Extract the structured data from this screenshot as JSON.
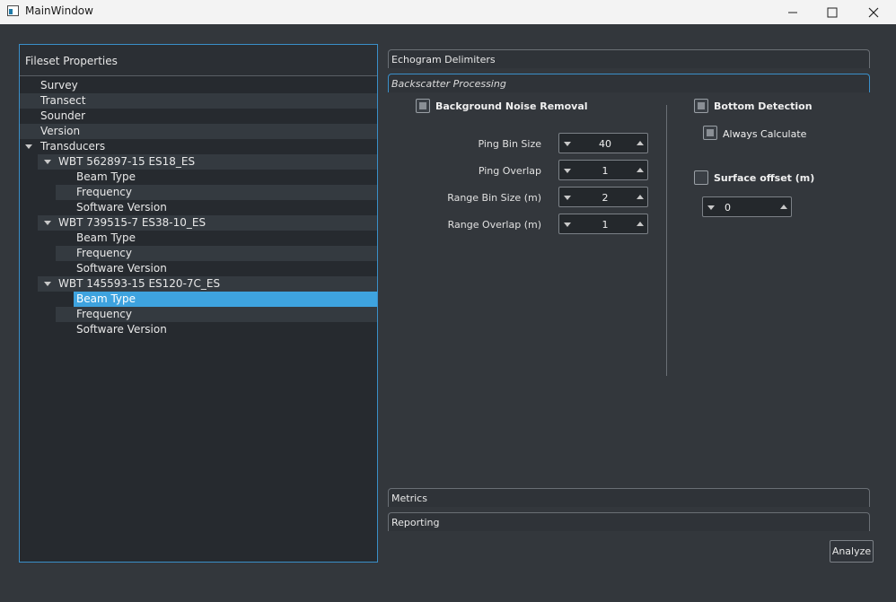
{
  "window": {
    "title": "MainWindow"
  },
  "left_panel": {
    "header": "Fileset Properties",
    "tree": [
      {
        "label": "Survey"
      },
      {
        "label": "Transect"
      },
      {
        "label": "Sounder"
      },
      {
        "label": "Version"
      },
      {
        "label": "Transducers"
      },
      {
        "label": "WBT 562897-15 ES18_ES"
      },
      {
        "label": "Beam Type"
      },
      {
        "label": "Frequency"
      },
      {
        "label": "Software Version"
      },
      {
        "label": "WBT 739515-7 ES38-10_ES"
      },
      {
        "label": "Beam Type"
      },
      {
        "label": "Frequency"
      },
      {
        "label": "Software Version"
      },
      {
        "label": "WBT 145593-15 ES120-7C_ES"
      },
      {
        "label": "Beam Type"
      },
      {
        "label": "Frequency"
      },
      {
        "label": "Software Version"
      }
    ]
  },
  "tabs": {
    "echogram": "Echogram Delimiters",
    "backscatter": "Backscatter Processing",
    "metrics": "Metrics",
    "reporting": "Reporting"
  },
  "noise_removal": {
    "label": "Background Noise Removal",
    "ping_bin_size": {
      "label": "Ping Bin Size",
      "value": "40"
    },
    "ping_overlap": {
      "label": "Ping Overlap",
      "value": "1"
    },
    "range_bin_size": {
      "label": "Range Bin Size (m)",
      "value": "2"
    },
    "range_overlap": {
      "label": "Range Overlap (m)",
      "value": "1"
    }
  },
  "bottom_detection": {
    "label": "Bottom Detection",
    "always_calculate": "Always Calculate"
  },
  "surface_offset": {
    "label": "Surface offset (m)",
    "value": "0"
  },
  "analyze_button": "Analyze",
  "colors": {
    "accent": "#3a8fc9",
    "selection": "#3ea3df",
    "background": "#33373c"
  }
}
